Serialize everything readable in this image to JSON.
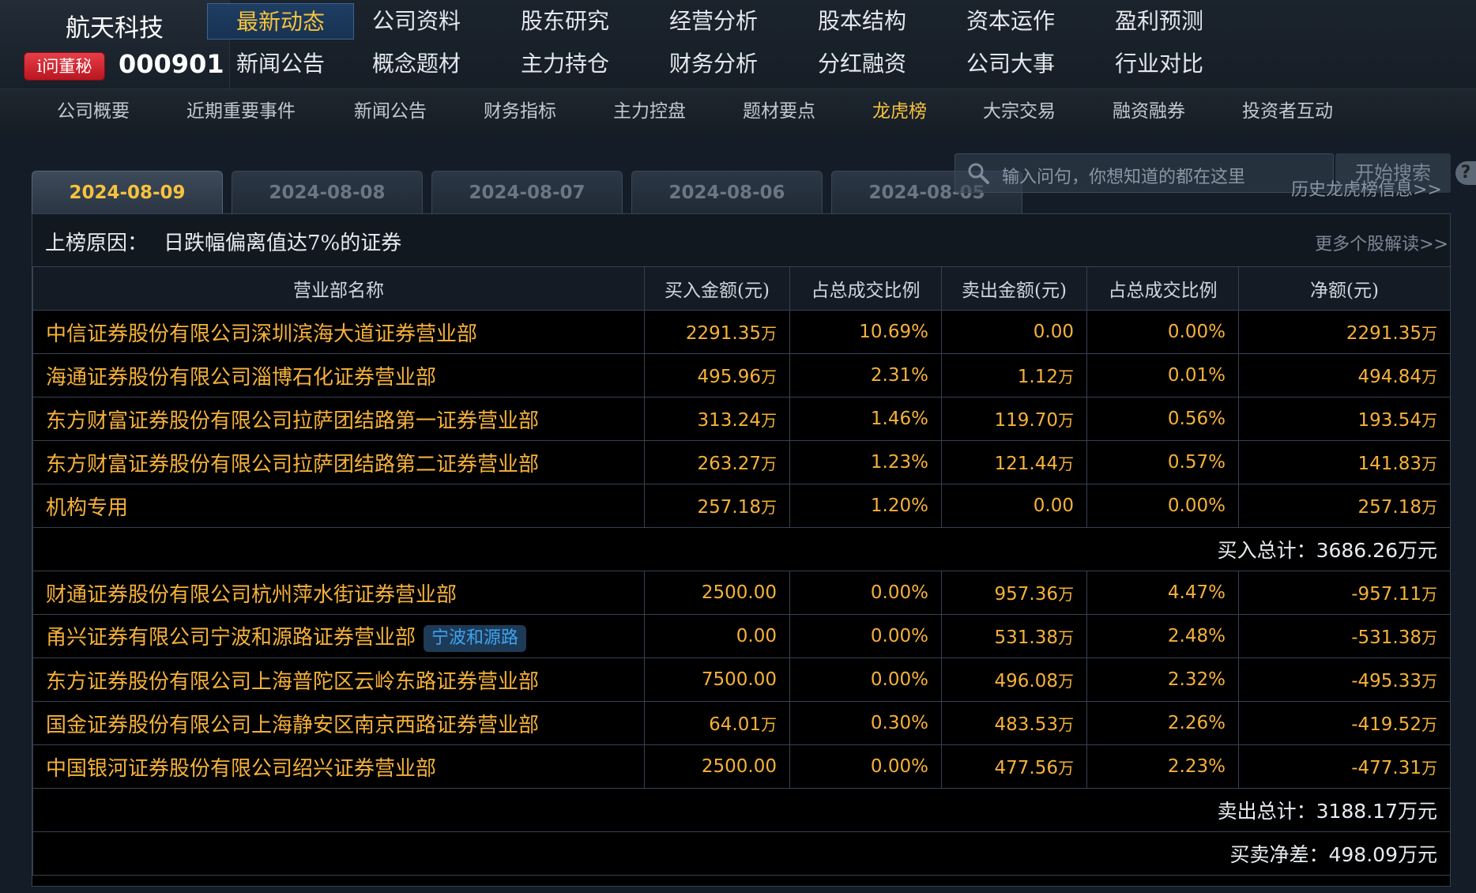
{
  "brand": {
    "name": "航天科技",
    "badge": "i问董秘",
    "code": "000901"
  },
  "nav_top": [
    [
      "最新动态",
      "公司资料",
      "股东研究",
      "经营分析",
      "股本结构",
      "资本运作",
      "盈利预测"
    ],
    [
      "新闻公告",
      "概念题材",
      "主力持仓",
      "财务分析",
      "分红融资",
      "公司大事",
      "行业对比"
    ]
  ],
  "nav_active": "最新动态",
  "subnav": [
    "公司概要",
    "近期重要事件",
    "新闻公告",
    "财务指标",
    "主力控盘",
    "题材要点",
    "龙虎榜",
    "大宗交易",
    "融资融券",
    "投资者互动"
  ],
  "subnav_active": "龙虎榜",
  "tabs": [
    "2024-08-09",
    "2024-08-08",
    "2024-08-07",
    "2024-08-06",
    "2024-08-05"
  ],
  "search": {
    "placeholder": "输入问句，你想知道的都在这里",
    "button": "开始搜索",
    "help": "?"
  },
  "history_link": "历史龙虎榜信息>>",
  "reason": {
    "label": "上榜原因：",
    "text": "日跌幅偏离值达7%的证券",
    "more": "更多个股解读>>"
  },
  "table": {
    "headers": [
      "营业部名称",
      "买入金额(元)",
      "占总成交比例",
      "卖出金额(元)",
      "占总成交比例",
      "净额(元)"
    ],
    "buy_rows": [
      {
        "name": "中信证券股份有限公司深圳滨海大道证券营业部",
        "buy": "2291.35",
        "buy_unit": "万",
        "buy_pct": "10.69%",
        "sell": "0.00",
        "sell_unit": "",
        "sell_pct": "0.00%",
        "net": "2291.35",
        "net_unit": "万"
      },
      {
        "name": "海通证券股份有限公司淄博石化证券营业部",
        "buy": "495.96",
        "buy_unit": "万",
        "buy_pct": "2.31%",
        "sell": "1.12",
        "sell_unit": "万",
        "sell_pct": "0.01%",
        "net": "494.84",
        "net_unit": "万"
      },
      {
        "name": "东方财富证券股份有限公司拉萨团结路第一证券营业部",
        "buy": "313.24",
        "buy_unit": "万",
        "buy_pct": "1.46%",
        "sell": "119.70",
        "sell_unit": "万",
        "sell_pct": "0.56%",
        "net": "193.54",
        "net_unit": "万"
      },
      {
        "name": "东方财富证券股份有限公司拉萨团结路第二证券营业部",
        "buy": "263.27",
        "buy_unit": "万",
        "buy_pct": "1.23%",
        "sell": "121.44",
        "sell_unit": "万",
        "sell_pct": "0.57%",
        "net": "141.83",
        "net_unit": "万"
      },
      {
        "name": "机构专用",
        "buy": "257.18",
        "buy_unit": "万",
        "buy_pct": "1.20%",
        "sell": "0.00",
        "sell_unit": "",
        "sell_pct": "0.00%",
        "net": "257.18",
        "net_unit": "万"
      }
    ],
    "buy_total": {
      "label": "买入总计：",
      "value": "3686.26",
      "unit": "万元"
    },
    "sell_rows": [
      {
        "name": "财通证券股份有限公司杭州萍水街证券营业部",
        "buy": "2500.00",
        "buy_unit": "",
        "buy_pct": "0.00%",
        "sell": "957.36",
        "sell_unit": "万",
        "sell_pct": "4.47%",
        "net": "-957.11",
        "net_unit": "万"
      },
      {
        "name": "甬兴证券有限公司宁波和源路证券营业部",
        "tag": "宁波和源路",
        "buy": "0.00",
        "buy_unit": "",
        "buy_pct": "0.00%",
        "sell": "531.38",
        "sell_unit": "万",
        "sell_pct": "2.48%",
        "net": "-531.38",
        "net_unit": "万"
      },
      {
        "name": "东方证券股份有限公司上海普陀区云岭东路证券营业部",
        "buy": "7500.00",
        "buy_unit": "",
        "buy_pct": "0.00%",
        "sell": "496.08",
        "sell_unit": "万",
        "sell_pct": "2.32%",
        "net": "-495.33",
        "net_unit": "万"
      },
      {
        "name": "国金证券股份有限公司上海静安区南京西路证券营业部",
        "buy": "64.01",
        "buy_unit": "万",
        "buy_pct": "0.30%",
        "sell": "483.53",
        "sell_unit": "万",
        "sell_pct": "2.26%",
        "net": "-419.52",
        "net_unit": "万"
      },
      {
        "name": "中国银河证券股份有限公司绍兴证券营业部",
        "buy": "2500.00",
        "buy_unit": "",
        "buy_pct": "0.00%",
        "sell": "477.56",
        "sell_unit": "万",
        "sell_pct": "2.23%",
        "net": "-477.31",
        "net_unit": "万"
      }
    ],
    "sell_total": {
      "label": "卖出总计：",
      "value": "3188.17",
      "unit": "万元"
    },
    "net_total": {
      "label": "买卖净差：",
      "value": "498.09",
      "unit": "万元"
    }
  },
  "colors": {
    "accent": "#f6c23e",
    "value": "#f6b13a",
    "background": "#000000",
    "border": "#364252",
    "badge": "#d21f2a",
    "tag": "#3fa3f0"
  }
}
